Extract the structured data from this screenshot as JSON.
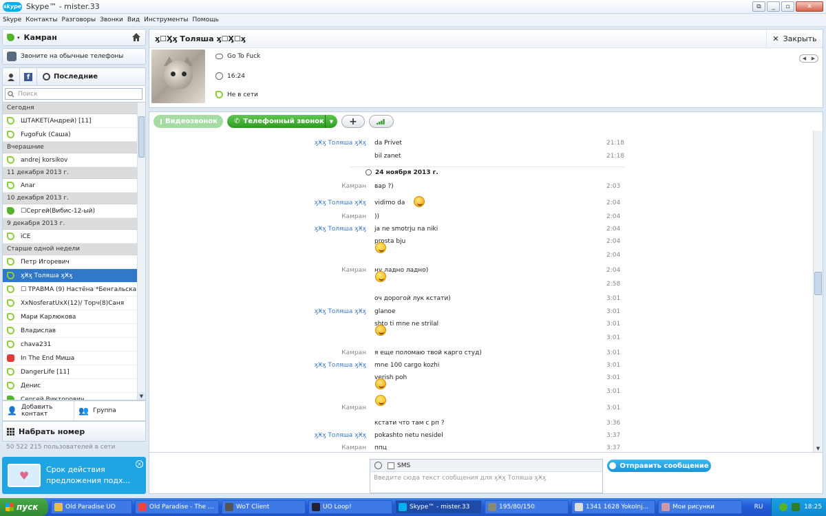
{
  "window": {
    "title": "Skype™ - mister.33",
    "logo_text": "skype"
  },
  "menu": [
    "Skype",
    "Контакты",
    "Разговоры",
    "Звонки",
    "Вид",
    "Инструменты",
    "Помощь"
  ],
  "left": {
    "user_name": "Камран",
    "phones_label": "Звоните на обычные телефоны",
    "tab_recent": "Последние",
    "search_placeholder": "Поиск",
    "add_contact": "Добавить контакт",
    "group": "Группа",
    "dial": "Набрать номер",
    "users_online": "50 522 215 пользователей в сети",
    "promo": {
      "line1": "Срок действия",
      "line2": "предложения подх..."
    }
  },
  "contacts": [
    {
      "type": "group",
      "label": "Сегодня"
    },
    {
      "type": "contact",
      "label": "ШТАКЕТ(Андрей) [11]",
      "status": "off"
    },
    {
      "type": "contact",
      "label": "FugoFuk (Саша)",
      "status": "off"
    },
    {
      "type": "group",
      "label": "Вчерашние"
    },
    {
      "type": "contact",
      "label": "andrej korsikov",
      "status": "off"
    },
    {
      "type": "group",
      "label": "11 декабря 2013 г."
    },
    {
      "type": "contact",
      "label": "Anar",
      "status": "off"
    },
    {
      "type": "group",
      "label": "10 декабря 2013 г."
    },
    {
      "type": "contact",
      "label": "☐Сергей(Вибис-12-ый)",
      "status": "on"
    },
    {
      "type": "group",
      "label": "9 декабря 2013 г."
    },
    {
      "type": "contact",
      "label": "iCE",
      "status": "off"
    },
    {
      "type": "group",
      "label": "Старше одной недели"
    },
    {
      "type": "contact",
      "label": "Петр Игоревич",
      "status": "off"
    },
    {
      "type": "contact",
      "label": "ӽӾӽ Толяша ӽӾӽ",
      "status": "off",
      "selected": true
    },
    {
      "type": "contact",
      "label": "☐ ТРАВМА (9) Настёна *Бенгальска...",
      "status": "off"
    },
    {
      "type": "contact",
      "label": "XxNosferatUxX(12)/ Торч(8)Саня",
      "status": "off"
    },
    {
      "type": "contact",
      "label": "Мари Карлюкова",
      "status": "off"
    },
    {
      "type": "contact",
      "label": "Владислав",
      "status": "off"
    },
    {
      "type": "contact",
      "label": "chava231",
      "status": "off"
    },
    {
      "type": "contact",
      "label": "In The End Миша",
      "status": "busy"
    },
    {
      "type": "contact",
      "label": "DangerLife [11]",
      "status": "off"
    },
    {
      "type": "contact",
      "label": "Денис",
      "status": "off"
    },
    {
      "type": "contact",
      "label": "Сергей Викторович",
      "status": "on"
    }
  ],
  "conversation": {
    "title": "ӽ☐Ӽӽ Толяша ӽ☐Ӽ☐ӽ",
    "close": "Закрыть",
    "mood": "Go To Fuck",
    "local_time": "16:24",
    "status": "Не в сети"
  },
  "callbar": {
    "video": "Видеозвонок",
    "call": "Телефонный звонок"
  },
  "messages": {
    "date_divider": "24 ноября 2013 г.",
    "names": {
      "k": "Камран",
      "t": "ӽӾӽ Толяша ӽӾӽ"
    },
    "rows": [
      {
        "who": "t",
        "text": "da Privet",
        "time": "21:18"
      },
      {
        "who": "",
        "text": "bil zanet",
        "time": "21:18"
      },
      {
        "who": "k",
        "text": "вар ?)",
        "time": "2:03"
      },
      {
        "who": "t",
        "text": "vidimo da",
        "time": "2:04",
        "smiley": "laugh"
      },
      {
        "who": "k",
        "text": "))",
        "time": "2:04"
      },
      {
        "who": "t",
        "text": "ja ne smotrju na niki",
        "time": "2:04"
      },
      {
        "who": "",
        "text": "prosta bju",
        "time": "2:04"
      },
      {
        "who": "",
        "text": "",
        "time": "2:04",
        "smiley": "smile"
      },
      {
        "who": "k",
        "text": "ну ладно ладно)",
        "time": "2:04"
      },
      {
        "who": "",
        "text": "",
        "time": "2:58",
        "smiley": "smile"
      },
      {
        "who": "",
        "text": "оч дорогой лук кстати)",
        "time": "3:01"
      },
      {
        "who": "t",
        "text": "glanoe",
        "time": "3:01"
      },
      {
        "who": "",
        "text": "shto ti mne ne strilal",
        "time": "3:01"
      },
      {
        "who": "",
        "text": "",
        "time": "3:01",
        "smiley": "laugh"
      },
      {
        "who": "k",
        "text": "я еще поломаю твой карго студ)",
        "time": "3:01"
      },
      {
        "who": "t",
        "text": "mne 100 cargo kozhi",
        "time": "3:01"
      },
      {
        "who": "",
        "text": "verish poh",
        "time": "3:01"
      },
      {
        "who": "",
        "text": "",
        "time": "3:01",
        "smiley": "laugh"
      },
      {
        "who": "k",
        "text": "",
        "time": "3:01",
        "smiley": "smile"
      },
      {
        "who": "",
        "text": "кстати что там с рп ?",
        "time": "3:36"
      },
      {
        "who": "t",
        "text": "pokashto netu nesidel",
        "time": "3:37"
      },
      {
        "who": "k",
        "text": "ппц",
        "time": "3:37"
      }
    ]
  },
  "input": {
    "sms_label": "SMS",
    "placeholder": "Введите сюда текст сообщения для ӽӾӽ Толяша ӽӾӽ",
    "send": "Отправить сообщение"
  },
  "taskbar": {
    "start": "пуск",
    "items": [
      "Old Paradise UO",
      "Old Paradise - The ...",
      "WoT Client",
      "UO Loop!",
      "Skype™ - mister.33",
      "195/80/150",
      "1341 1628 YokoInj...",
      "Мои рисунки"
    ],
    "lang": "RU",
    "clock": "18:25"
  }
}
